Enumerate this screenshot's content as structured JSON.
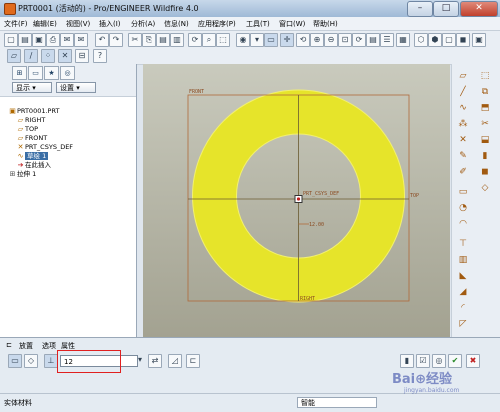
{
  "window": {
    "title": "PRT0001 (活动的) - Pro/ENGINEER Wildfire 4.0",
    "controls": {
      "minimize": "–",
      "maximize": "□",
      "close": "✕"
    }
  },
  "menu": [
    "文件(F)",
    "编辑(E)",
    "视图(V)",
    "插入(I)",
    "分析(A)",
    "信息(N)",
    "应用程序(P)",
    "工具(T)",
    "窗口(W)",
    "帮助(H)"
  ],
  "left_panel": {
    "show_label": "显示 ▾",
    "settings_label": "设置 ▾",
    "tree": [
      {
        "label": "PRT0001.PRT",
        "icon": "part-icon",
        "glyph": "▣"
      },
      {
        "label": "RIGHT",
        "icon": "datum-plane-icon",
        "glyph": "▱"
      },
      {
        "label": "TOP",
        "icon": "datum-plane-icon",
        "glyph": "▱"
      },
      {
        "label": "FRONT",
        "icon": "datum-plane-icon",
        "glyph": "▱"
      },
      {
        "label": "PRT_CSYS_DEF",
        "icon": "csys-icon",
        "glyph": "✕"
      },
      {
        "label": "草绘 1",
        "icon": "sketch-icon",
        "glyph": "∿"
      },
      {
        "label": "在此插入",
        "icon": "insert-arrow-icon",
        "glyph": "➔"
      },
      {
        "label": "拉伸 1",
        "icon": "extrude-icon",
        "glyph": "⊞"
      }
    ]
  },
  "graphics": {
    "labels": {
      "front": "FRONT",
      "csys": "PRT_CSYS_DEF",
      "top": "TOP",
      "dim": "12.00",
      "right": "RIGHT"
    },
    "colors": {
      "ring": "#e6e42a",
      "datum": "#b06a3a",
      "bg_top": "#c9cabd",
      "bg_bottom": "#a3a291"
    }
  },
  "dashboard": {
    "tabs": [
      "放置",
      "选项",
      "属性"
    ],
    "depth_value": "12",
    "confirm_icon": "check-icon",
    "cancel_icon": "cancel-icon"
  },
  "status": {
    "message": "实体材料",
    "mode": "智能"
  },
  "watermark": {
    "text": "Bai⊕经验",
    "site": "jingyan.baidu.com"
  }
}
